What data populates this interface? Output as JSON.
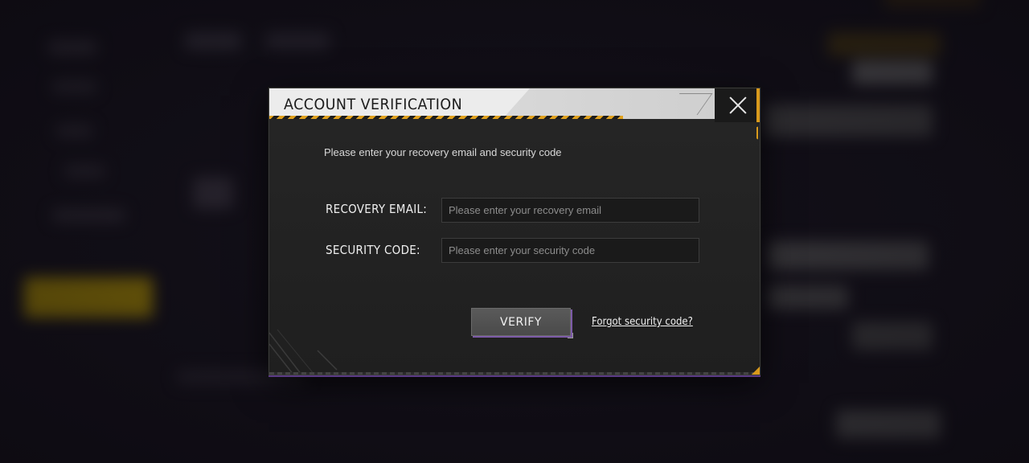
{
  "dialog": {
    "title": "ACCOUNT VERIFICATION",
    "subtitle": "Please enter your recovery email and security code",
    "email_label": "RECOVERY EMAIL:",
    "email_placeholder": "Please enter your recovery email",
    "email_value": "",
    "code_label": "SECURITY CODE:",
    "code_placeholder": "Please enter your security code",
    "code_value": "",
    "verify_label": "VERIFY",
    "forgot_label": "Forgot security code?",
    "close_icon": "close-icon"
  },
  "colors": {
    "accent_orange": "#d99a1c",
    "hazard_stripe": "#e0a11e",
    "dialog_bg": "#232323",
    "title_bg": "#ececec",
    "highlight_yellow": "#e8b800",
    "button_shadow_purple": "#7c5aa8"
  }
}
